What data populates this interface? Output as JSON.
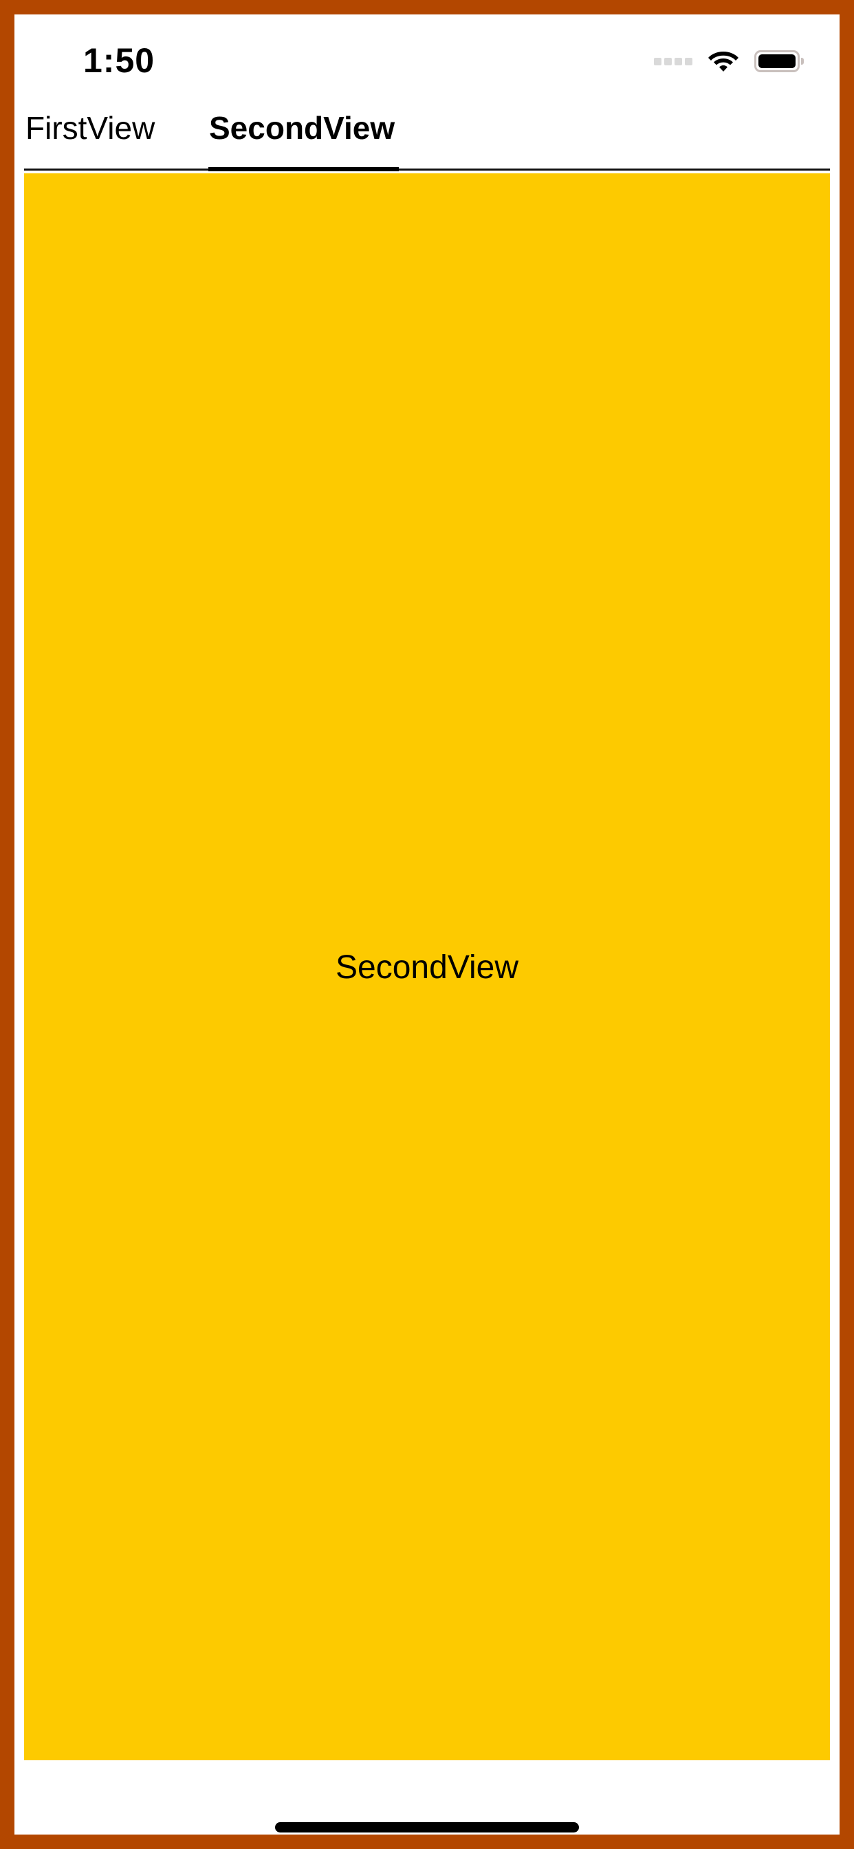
{
  "status_bar": {
    "time": "1:50",
    "icons": [
      "cellular-signal-icon",
      "wifi-icon",
      "battery-icon"
    ]
  },
  "tabs": [
    {
      "label": "FirstView",
      "selected": false
    },
    {
      "label": "SecondView",
      "selected": true
    }
  ],
  "content": {
    "label": "SecondView",
    "background_color": "#FDCA00"
  },
  "colors": {
    "frame": "#B34700",
    "indicator": "#000000",
    "content_background": "#FDCA00"
  }
}
